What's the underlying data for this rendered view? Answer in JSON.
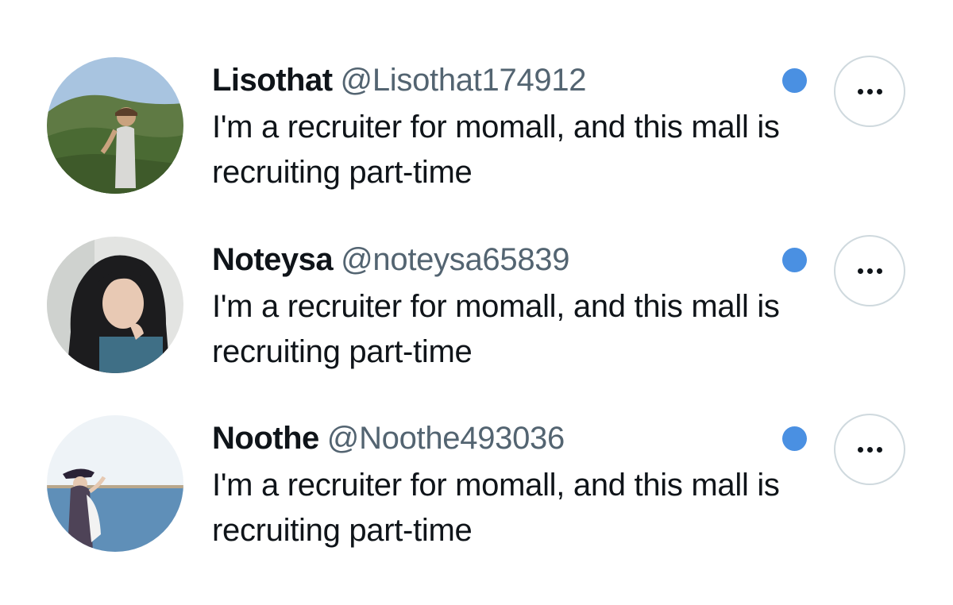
{
  "suggestions": [
    {
      "display_name": "Lisothat",
      "handle": "@Lisothat174912",
      "bio": "I'm a recruiter for momall, and this mall is recruiting part-time",
      "avatar_icon": "avatar-photo-woman-hiking",
      "unread_dot_color": "#4a90e2"
    },
    {
      "display_name": "Noteysa",
      "handle": "@noteysa65839",
      "bio": "I'm a recruiter for momall, and this mall is recruiting part-time",
      "avatar_icon": "avatar-photo-woman-portrait",
      "unread_dot_color": "#4a90e2"
    },
    {
      "display_name": "Noothe",
      "handle": "@Noothe493036",
      "bio": "I'm a recruiter for momall, and this mall is recruiting part-time",
      "avatar_icon": "avatar-photo-woman-lake",
      "unread_dot_color": "#4a90e2"
    }
  ],
  "more_button_icon": "more-horizontal-icon"
}
